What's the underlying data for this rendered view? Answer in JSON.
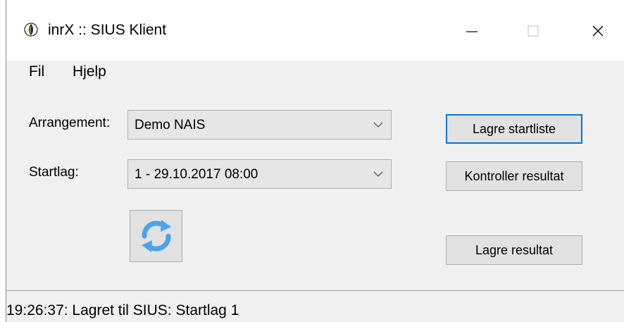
{
  "window": {
    "title": "inrX :: SIUS Klient",
    "icon": "inrx-logo-icon"
  },
  "menu": {
    "items": [
      {
        "label": "Fil"
      },
      {
        "label": "Hjelp"
      }
    ]
  },
  "form": {
    "arrangement_label": "Arrangement:",
    "arrangement_value": "Demo NAIS",
    "startlag_label": "Startlag:",
    "startlag_value": "1 - 29.10.2017 08:00"
  },
  "buttons": {
    "lagre_startliste": "Lagre startliste",
    "kontroller_resultat": "Kontroller resultat",
    "lagre_resultat": "Lagre resultat",
    "refresh_icon": "refresh-icon"
  },
  "status": {
    "text": "19:26:37: Lagret til SIUS: Startlag 1"
  },
  "colors": {
    "accent_focus": "#0078d7",
    "refresh_icon": "#4aa3ec"
  }
}
